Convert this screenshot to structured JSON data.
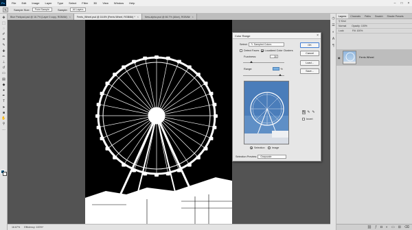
{
  "app": {
    "logo": "Ps"
  },
  "menu": [
    "File",
    "Edit",
    "Image",
    "Layer",
    "Type",
    "Select",
    "Filter",
    "3D",
    "View",
    "Window",
    "Help"
  ],
  "options_bar": {
    "sample_size_label": "Sample Size:",
    "sample_size_value": "Point Sample",
    "sample_label": "Sample:",
    "sample_value": "All Layers"
  },
  "tabs": [
    {
      "label": "Blue Parkpad.psd @ 16.7% (Layer 0 copy, RGB/8#)",
      "active": false
    },
    {
      "label": "Ferris_Wheel.psd @ 16.6% (Ferris Wheel, RGB/8#) *",
      "active": true
    },
    {
      "label": "New-alpha.psd @ 66.7% (Alice), RGB/8#",
      "active": false
    }
  ],
  "status": {
    "zoom": "16.67%",
    "doc": "Efficiency: 100%*"
  },
  "panel": {
    "tabs": [
      "Layers",
      "Channels",
      "Paths",
      "Swatch",
      "Shader Presets"
    ],
    "kind_label": "Kind",
    "blend_label": "Normal",
    "opacity_label": "Opacity: 100%",
    "lock_label": "Lock:",
    "fill_label": "Fill: 100%",
    "layer_name": "Ferris Wheel"
  },
  "dialog": {
    "title": "Color Range",
    "select_label": "Select:",
    "select_value": "Sampled Colors",
    "detect_faces": "Detect Faces",
    "localized": "Localized Color Clusters",
    "fuzziness_label": "Fuzziness:",
    "fuzziness_value": "30",
    "range_label": "Range:",
    "range_unit": "%",
    "selection_label": "Selection",
    "image_label": "Image",
    "preview_label": "Selection Preview:",
    "preview_value": "Grayscale",
    "ok": "OK",
    "cancel": "Cancel",
    "load": "Load...",
    "save": "Save...",
    "invert": "Invert"
  },
  "colors": {
    "foreground": "#0d4f73",
    "background": "#ffffff",
    "accent": "#3d7bd3"
  }
}
